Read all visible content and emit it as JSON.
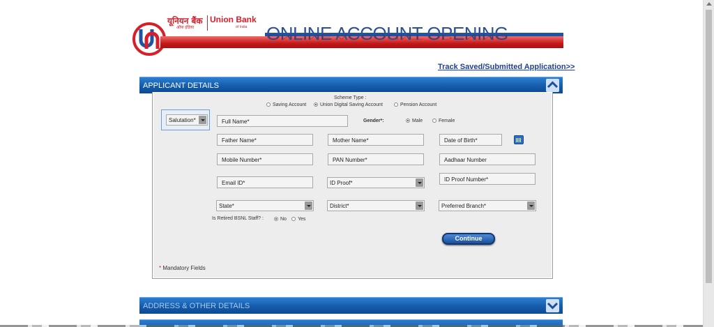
{
  "header": {
    "logo_hindi": "यूनियन बैंक",
    "logo_english": "Union Bank",
    "logo_hindi_small": "ऑफ इंडिया",
    "logo_english_small": "of India",
    "banner_title": "ONLINE ACCOUNT OPENING",
    "brand_red": "#d5202a",
    "brand_blue": "#1c55a6"
  },
  "track_link": "Track Saved/Submitted Application>>",
  "sections": {
    "applicant": {
      "title": "APPLICANT DETAILS",
      "icon": "chevron-up-icon"
    },
    "address": {
      "title": "ADDRESS & OTHER DETAILS",
      "icon": "chevron-down-icon"
    }
  },
  "form": {
    "scheme_label": "Scheme Type :",
    "scheme_options": [
      "Saving Account",
      "Union Digital Saving Account",
      "Pension Account"
    ],
    "scheme_selected": "Union Digital Saving Account",
    "salutation": "Salutation*",
    "full_name": "Full Name*",
    "gender_label": "Gender*:",
    "gender_options": [
      "Male",
      "Female"
    ],
    "gender_selected": "Male",
    "father_name": "Father Name*",
    "mother_name": "Mother Name*",
    "dob": "Date of Birth*",
    "mobile": "Mobile Number*",
    "pan": "PAN Number*",
    "aadhaar": "Aadhaar Number",
    "email": "Email ID*",
    "id_proof": "ID Proof*",
    "id_proof_number": "ID Proof Number*",
    "state": "State*",
    "district": "District*",
    "branch": "Preferred Branch*",
    "bsnl_label": "Is Retired BSNL Staff? :",
    "bsnl_options": [
      "No",
      "Yes"
    ],
    "bsnl_selected": "No",
    "continue_label": "Continue",
    "mandatory_star": "*",
    "mandatory_text": "Mandatory Fields"
  }
}
